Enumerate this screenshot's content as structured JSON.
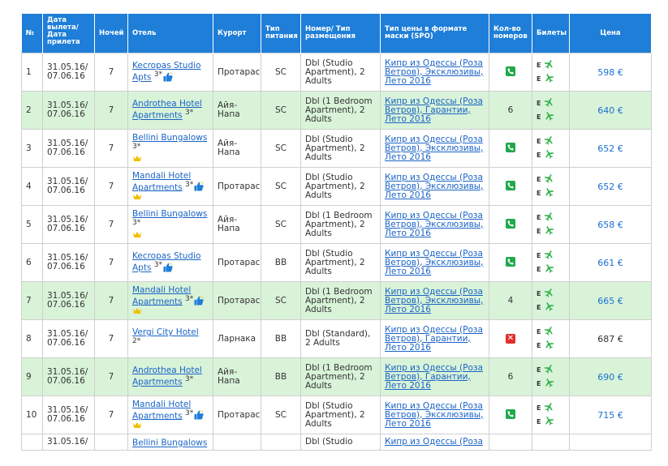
{
  "headers": {
    "num": "№",
    "date": "Дата вылета/ Дата прилета",
    "nights": "Ночей",
    "hotel": "Отель",
    "resort": "Курорт",
    "meal": "Тип питания",
    "room": "Номер/ Тип размещения",
    "spo": "Тип цены в формате маски (SPO)",
    "rooms_count": "Кол-во номеров",
    "tickets": "Билеты",
    "price": "Цена"
  },
  "rows": [
    {
      "num": "1",
      "date": "31.05.16/ 07.06.16",
      "nights": "7",
      "hotel": "Kecropas Studio Apts",
      "stars": "3*",
      "thumb": true,
      "crown": false,
      "resort": "Протарас",
      "meal": "SC",
      "room": "Dbl (Studio Apartment), 2 Adults",
      "spo": "Кипр из Одессы (Роза Ветров), Эксклюзивы, Лето 2016",
      "avail": "phone",
      "rooms": "",
      "ticket_e": "E",
      "price": "598 €",
      "green": false,
      "price_dark": false
    },
    {
      "num": "2",
      "date": "31.05.16/ 07.06.16",
      "nights": "7",
      "hotel": "Androthea Hotel Apartments",
      "stars": "3*",
      "thumb": false,
      "crown": false,
      "resort": "Айя-Напа",
      "meal": "SC",
      "room": "Dbl (1 Bedroom Apartment), 2 Adults",
      "spo": "Кипр из Одессы (Роза Ветров), Гарантии, Лето 2016",
      "avail": "count",
      "rooms": "6",
      "ticket_e": "E",
      "price": "640 €",
      "green": true,
      "price_dark": false
    },
    {
      "num": "3",
      "date": "31.05.16/ 07.06.16",
      "nights": "7",
      "hotel": "Bellini Bungalows",
      "stars": "3*",
      "thumb": false,
      "crown": true,
      "resort": "Айя-Напа",
      "meal": "SC",
      "room": "Dbl (Studio Apartment), 2 Adults",
      "spo": "Кипр из Одессы (Роза Ветров), Эксклюзивы, Лето 2016",
      "avail": "phone",
      "rooms": "",
      "ticket_e": "E",
      "price": "652 €",
      "green": false,
      "price_dark": false
    },
    {
      "num": "4",
      "date": "31.05.16/ 07.06.16",
      "nights": "7",
      "hotel": "Mandali Hotel Apartments",
      "stars": "3*",
      "thumb": true,
      "crown": true,
      "resort": "Протарас",
      "meal": "SC",
      "room": "Dbl (Studio Apartment), 2 Adults",
      "spo": "Кипр из Одессы (Роза Ветров), Эксклюзивы, Лето 2016",
      "avail": "phone",
      "rooms": "",
      "ticket_e": "E",
      "price": "652 €",
      "green": false,
      "price_dark": false
    },
    {
      "num": "5",
      "date": "31.05.16/ 07.06.16",
      "nights": "7",
      "hotel": "Bellini Bungalows",
      "stars": "3*",
      "thumb": false,
      "crown": true,
      "resort": "Айя-Напа",
      "meal": "SC",
      "room": "Dbl (1 Bedroom Apartment), 2 Adults",
      "spo": "Кипр из Одессы (Роза Ветров), Эксклюзивы, Лето 2016",
      "avail": "phone",
      "rooms": "",
      "ticket_e": "E",
      "price": "658 €",
      "green": false,
      "price_dark": false
    },
    {
      "num": "6",
      "date": "31.05.16/ 07.06.16",
      "nights": "7",
      "hotel": "Kecropas Studio Apts",
      "stars": "3*",
      "thumb": true,
      "crown": false,
      "resort": "Протарас",
      "meal": "BB",
      "room": "Dbl (Studio Apartment), 2 Adults",
      "spo": "Кипр из Одессы (Роза Ветров), Эксклюзивы, Лето 2016",
      "avail": "phone",
      "rooms": "",
      "ticket_e": "E",
      "price": "661 €",
      "green": false,
      "price_dark": false
    },
    {
      "num": "7",
      "date": "31.05.16/ 07.06.16",
      "nights": "7",
      "hotel": "Mandali Hotel Apartments",
      "stars": "3*",
      "thumb": true,
      "crown": true,
      "resort": "Протарас",
      "meal": "SC",
      "room": "Dbl (1 Bedroom Apartment), 2 Adults",
      "spo": "Кипр из Одессы (Роза Ветров), Эксклюзивы, Лето 2016",
      "avail": "count",
      "rooms": "4",
      "ticket_e": "E",
      "price": "665 €",
      "green": true,
      "price_dark": false
    },
    {
      "num": "8",
      "date": "31.05.16/ 07.06.16",
      "nights": "7",
      "hotel": "Vergi City Hotel",
      "stars": "2*",
      "thumb": false,
      "crown": false,
      "resort": "Ларнака",
      "meal": "BB",
      "room": "Dbl (Standard), 2 Adults",
      "spo": "Кипр из Одессы (Роза Ветров), Гарантии, Лето 2016",
      "avail": "x",
      "rooms": "",
      "ticket_e": "E",
      "price": "687 €",
      "green": false,
      "price_dark": true
    },
    {
      "num": "9",
      "date": "31.05.16/ 07.06.16",
      "nights": "7",
      "hotel": "Androthea Hotel Apartments",
      "stars": "3*",
      "thumb": false,
      "crown": false,
      "resort": "Айя-Напа",
      "meal": "BB",
      "room": "Dbl (1 Bedroom Apartment), 2 Adults",
      "spo": "Кипр из Одессы (Роза Ветров), Гарантии, Лето 2016",
      "avail": "count",
      "rooms": "6",
      "ticket_e": "E",
      "price": "690 €",
      "green": true,
      "price_dark": false
    },
    {
      "num": "10",
      "date": "31.05.16/ 07.06.16",
      "nights": "7",
      "hotel": "Mandali Hotel Apartments",
      "stars": "3*",
      "thumb": true,
      "crown": true,
      "resort": "Протарас",
      "meal": "SC",
      "room": "Dbl (Studio Apartment), 2 Adults",
      "spo": "Кипр из Одессы (Роза Ветров), Эксклюзивы, Лето 2016",
      "avail": "phone",
      "rooms": "",
      "ticket_e": "E",
      "price": "715 €",
      "green": false,
      "price_dark": false
    },
    {
      "num": "",
      "date": "31.05.16/",
      "nights": "",
      "hotel": "Bellini Bungalows",
      "stars": "",
      "thumb": false,
      "crown": false,
      "resort": "",
      "meal": "",
      "room": "Dbl (Studio",
      "spo": "Кипр из Одессы (Роза",
      "avail": "none",
      "rooms": "",
      "ticket_e": "",
      "price": "",
      "green": false,
      "price_dark": false
    }
  ],
  "colors": {
    "header_bg": "#1e7ed8",
    "row_green": "#d9f3d9",
    "link": "#1a63c6",
    "price": "#1a6fd1",
    "phone_badge": "#1fa94b",
    "x_badge": "#e02d2d",
    "plane": "#2fb24a",
    "crown": "#f0c000",
    "thumb": "#1e7ed8"
  },
  "icons": {
    "phone": "phone-icon",
    "unavailable": "close-icon",
    "crown": "crown-icon",
    "thumb": "thumbs-up-icon",
    "plane_out": "plane-departure-icon",
    "plane_back": "plane-arrival-icon"
  }
}
